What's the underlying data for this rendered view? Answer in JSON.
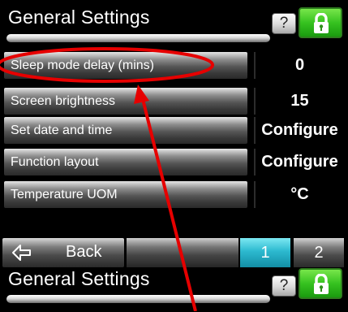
{
  "header": {
    "title": "General Settings",
    "help_label": "?"
  },
  "settings_rows": [
    {
      "label": "Sleep mode delay (mins)",
      "value": "0"
    },
    {
      "label": "Screen brightness",
      "value": "15"
    },
    {
      "label": "Set date and time",
      "value": "Configure"
    },
    {
      "label": "Function layout",
      "value": "Configure"
    },
    {
      "label": "Temperature UOM",
      "value": "°C"
    }
  ],
  "nav": {
    "back_label": "Back",
    "page_1": "1",
    "page_2": "2",
    "active_page": 1
  },
  "second_header": {
    "title": "General Settings",
    "help_label": "?"
  },
  "colors": {
    "lock_green": "#36c220",
    "active_page_cyan": "#2cb9cf",
    "annotation_red": "#e60000"
  }
}
